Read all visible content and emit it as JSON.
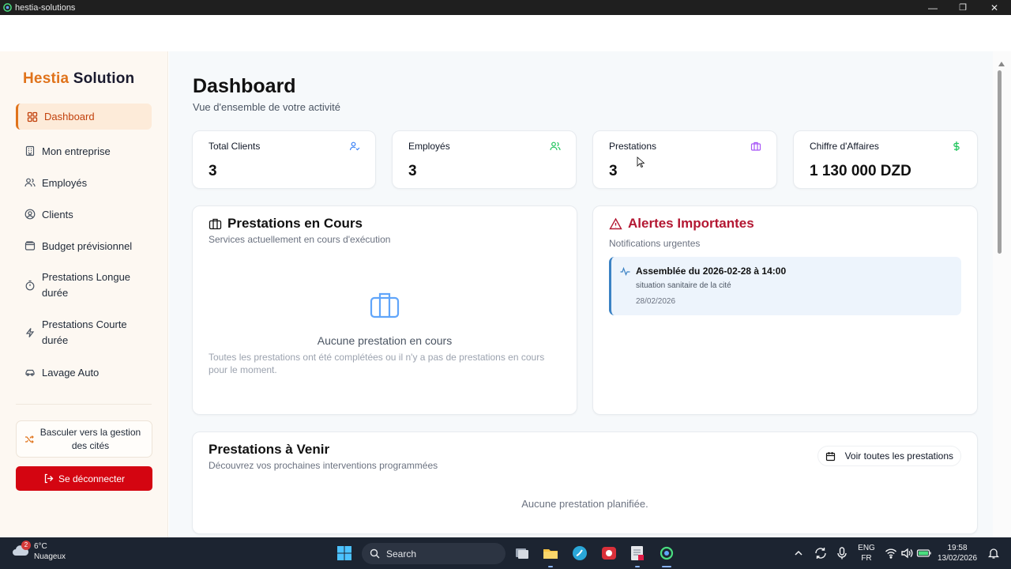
{
  "window": {
    "title": "hestia-solutions",
    "controls": {
      "minimize": "—",
      "maximize": "❐",
      "close": "✕"
    }
  },
  "sidebar": {
    "brand_a": "Hestia",
    "brand_b": "Solution",
    "items": [
      {
        "label": "Dashboard",
        "icon": "grid-icon",
        "active": true
      },
      {
        "label": "Mon entreprise",
        "icon": "building-icon"
      },
      {
        "label": "Employés",
        "icon": "users-icon"
      },
      {
        "label": "Clients",
        "icon": "user-circle-icon"
      },
      {
        "label": "Budget prévisionnel",
        "icon": "wallet-icon"
      },
      {
        "label": "Prestations Longue durée",
        "icon": "timer-icon"
      },
      {
        "label": "Prestations Courte durée",
        "icon": "zap-icon"
      },
      {
        "label": "Lavage Auto",
        "icon": "car-icon"
      }
    ],
    "switch_label": "Basculer vers la gestion des cités",
    "logout_label": "Se déconnecter"
  },
  "header": {
    "title": "Dashboard",
    "subtitle": "Vue d'ensemble de votre activité"
  },
  "stats": [
    {
      "label": "Total Clients",
      "value": "3",
      "icon": "user-check-icon",
      "color": "#3b82f6"
    },
    {
      "label": "Employés",
      "value": "3",
      "icon": "users-icon",
      "color": "#22c55e"
    },
    {
      "label": "Prestations",
      "value": "3",
      "icon": "briefcase-icon",
      "color": "#a855f7"
    },
    {
      "label": "Chiffre d'Affaires",
      "value": "1 130 000 DZD",
      "icon": "dollar-icon",
      "color": "#22c55e"
    }
  ],
  "ongoing": {
    "title": "Prestations en Cours",
    "subtitle": "Services actuellement en cours d'exécution",
    "empty_title": "Aucune prestation en cours",
    "empty_desc": "Toutes les prestations ont été complétées ou il n'y a pas de prestations en cours pour le moment."
  },
  "alerts": {
    "title": "Alertes Importantes",
    "subtitle": "Notifications urgentes",
    "items": [
      {
        "title": "Assemblée du 2026-02-28 à 14:00",
        "desc": "situation sanitaire de la cité",
        "date": "28/02/2026"
      }
    ]
  },
  "upcoming": {
    "title": "Prestations à Venir",
    "subtitle": "Découvrez vos prochaines interventions programmées",
    "view_all": "Voir toutes les prestations",
    "empty": "Aucune prestation planifiée."
  },
  "taskbar": {
    "weather_badge": "2",
    "temperature": "6°C",
    "condition": "Nuageux",
    "search_placeholder": "Search",
    "lang_top": "ENG",
    "lang_bottom": "FR",
    "time": "19:58",
    "date": "13/02/2026"
  },
  "colors": {
    "brand_orange": "#e0731b",
    "logout_red": "#d40511",
    "alert_red": "#b31732",
    "alert_blue": "#3b82c4"
  }
}
